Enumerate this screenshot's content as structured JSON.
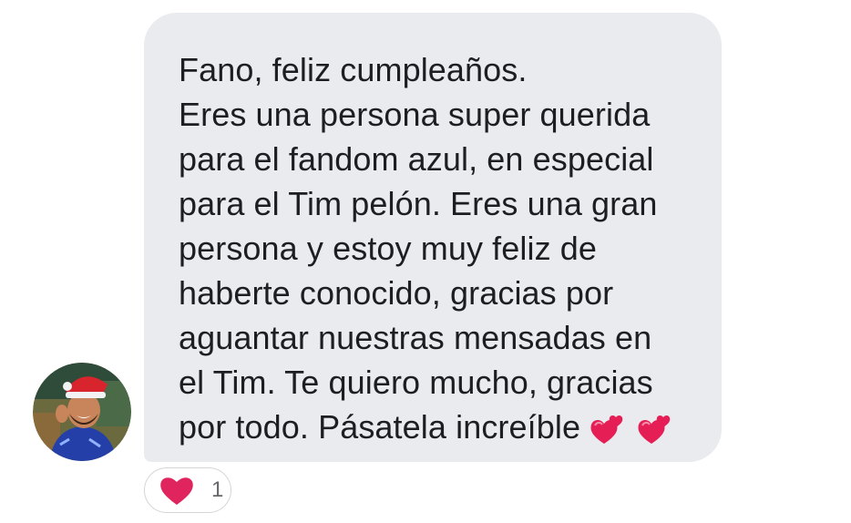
{
  "message": {
    "lines": [
      "Fano, feliz cumpleaños.",
      "Eres una persona super querida",
      "para el fandom azul, en especial",
      "para el Tim pelón. Eres una gran",
      "persona y estoy muy feliz de",
      "haberte conocido, gracias por",
      "aguantar nuestras mensadas en",
      "el Tim. Te quiero mucho, gracias",
      "por todo. Pásatela increíble"
    ],
    "emoji": [
      "two-hearts-icon",
      "two-hearts-icon"
    ],
    "bubble_color": "#e9ebef",
    "text_color": "#1c1e21"
  },
  "sender": {
    "avatar_icon": "avatar"
  },
  "reaction": {
    "icon": "heart-icon",
    "count": "1",
    "color": "#e0245e"
  }
}
